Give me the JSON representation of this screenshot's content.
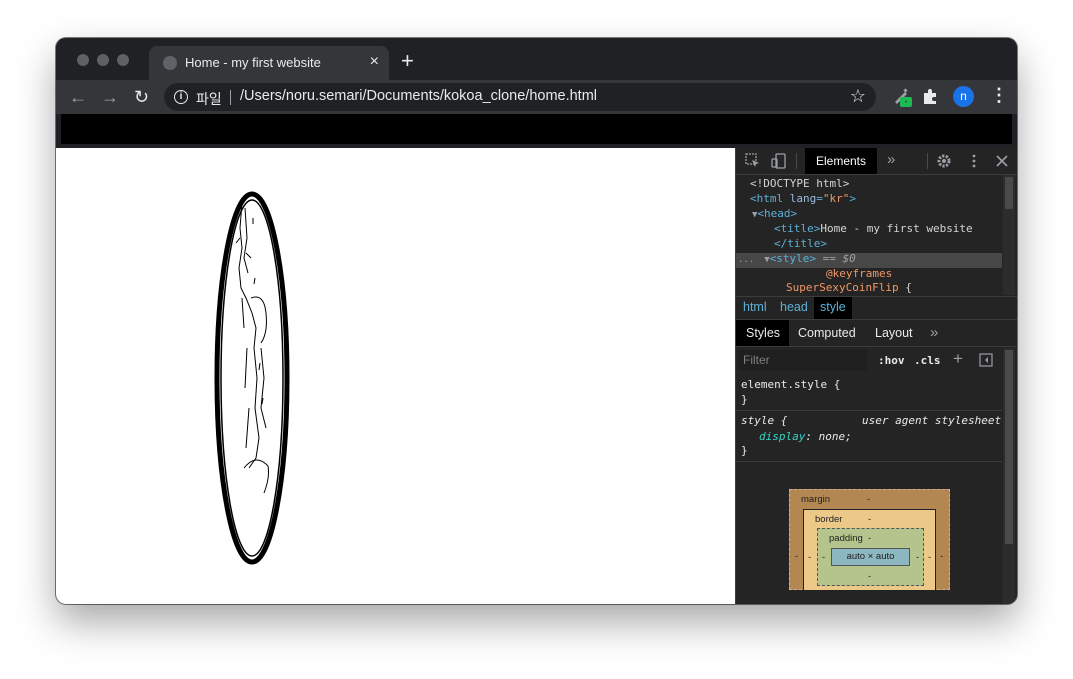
{
  "browser": {
    "tab_title": "Home - my first website",
    "tab_close": "×",
    "new_tab": "+",
    "back": "←",
    "forward": "→",
    "reload": "↻",
    "info_chip": "i",
    "site_label": "파일",
    "url": "/Users/noru.semari/Documents/kokoa_clone/home.html",
    "bookmark": "☆",
    "extension_badge": "-",
    "avatar_letter": "n",
    "menu": "⋮"
  },
  "devtools": {
    "main_tab": "Elements",
    "more_tabs": "»",
    "dom_lines": {
      "doctype": "<!DOCTYPE html>",
      "html_open_tag": "<html",
      "html_attr_name": "lang",
      "html_attr_value": "\"kr\"",
      "html_close_bracket": ">",
      "head_arrow": "▼",
      "head_tag": "<head>",
      "title_open": "<title>",
      "title_text": "Home - my first website",
      "title_close": "</title>",
      "style_dots": "...",
      "style_arrow": "▼",
      "style_tag": "<style>",
      "style_ref": "== $0",
      "keyframes": "@keyframes",
      "keyframes_name": "SuperSexyCoinFlip",
      "brace": "{"
    },
    "breadcrumbs": [
      "html",
      "head",
      "style"
    ],
    "subtabs": [
      "Styles",
      "Computed",
      "Layout"
    ],
    "subtabs_more": "»",
    "filter_placeholder": "Filter",
    "hov": ":hov",
    "cls": ".cls",
    "add_rule": "+",
    "element_style_selector": "element.style {",
    "close_brace": "}",
    "ua_selector": "style {",
    "ua_source": "user agent stylesheet",
    "ua_property": "display",
    "ua_value": "none;",
    "box_model": {
      "margin_label": "margin",
      "border_label": "border",
      "padding_label": "padding",
      "dash": "-",
      "content": "auto × auto"
    }
  }
}
